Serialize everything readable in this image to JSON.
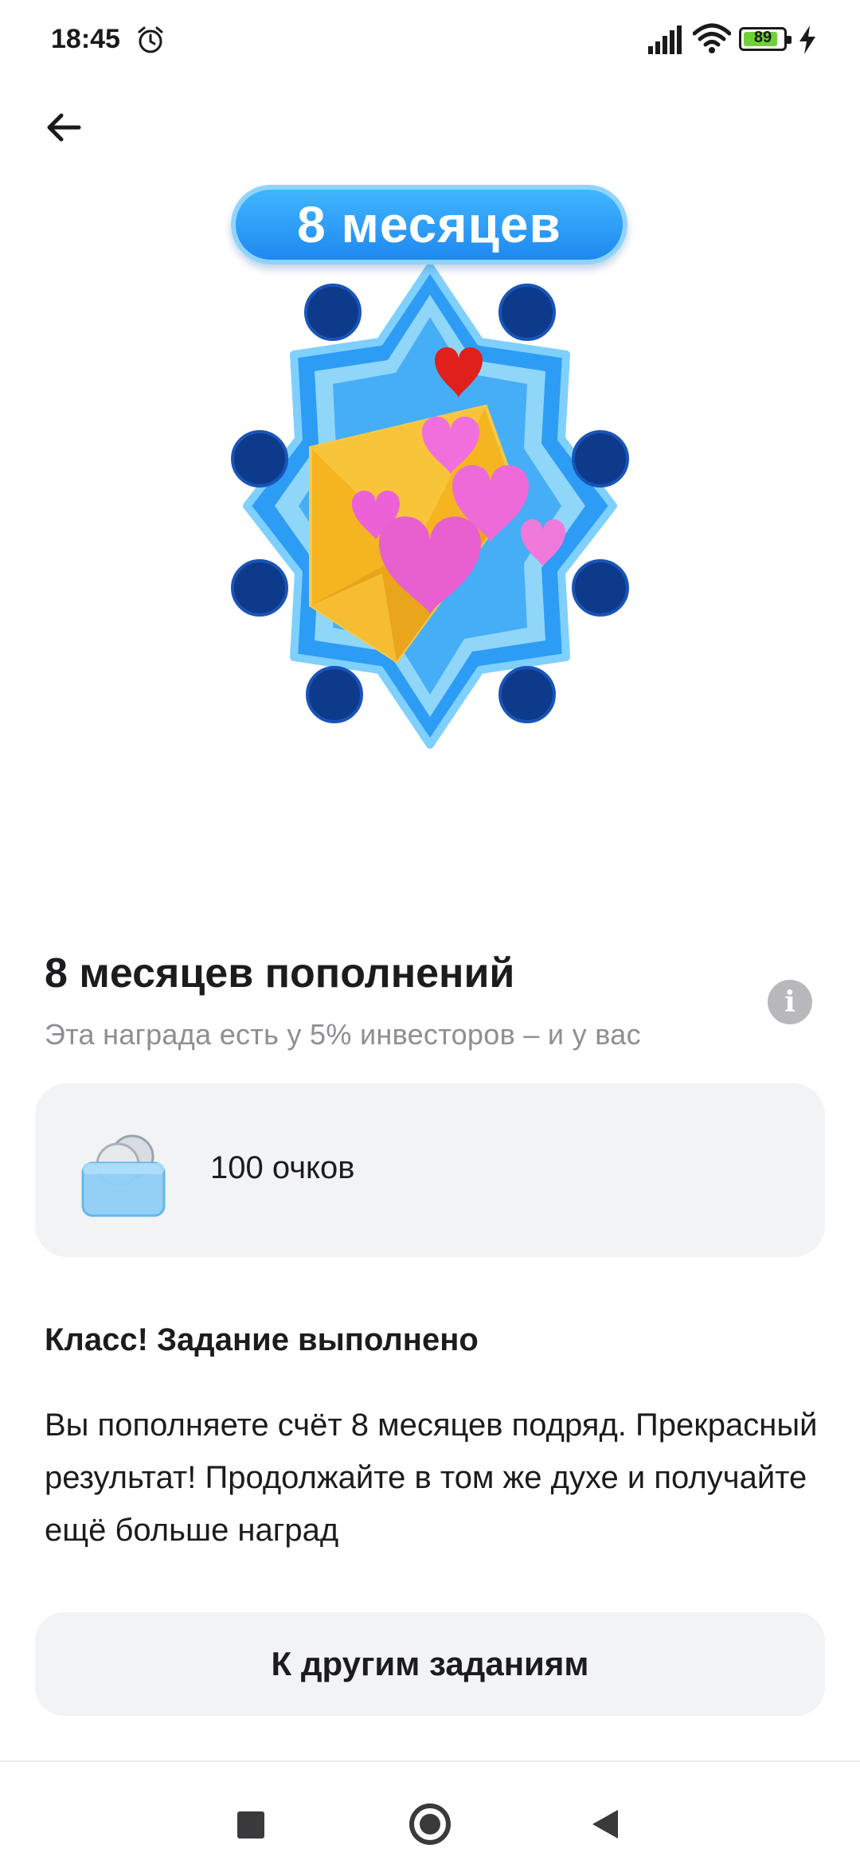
{
  "status_bar": {
    "time": "18:45",
    "battery_level": "89",
    "battery_fraction": 0.89,
    "icons": [
      "alarm-icon",
      "signal-icon",
      "wifi-icon",
      "battery-icon",
      "charging-icon"
    ]
  },
  "toolbar": {
    "back_icon": "arrow-left-icon"
  },
  "medal": {
    "ribbon_text": "8 месяцев",
    "image": "envelope-with-hearts-badge"
  },
  "award": {
    "title": "8 месяцев пополнений",
    "subtitle": "Эта награда есть у 5% инвесторов – и у вас",
    "info_icon": "info-icon"
  },
  "points_card": {
    "icon": "coins-icon",
    "label": "100 очков"
  },
  "task": {
    "heading": "Класс! Задание выполнено",
    "body": "Вы пополняете счёт 8 месяцев подряд. Прекрасный результат! Продолжайте в том же духе и получайте ещё больше наград"
  },
  "cta": {
    "label": "К другим заданиям"
  },
  "nav_bar": {
    "icons": [
      "recents-icon",
      "home-icon",
      "back-icon"
    ]
  },
  "colors": {
    "medal_blue": "#1e88f0",
    "envelope_yellow": "#f4b521",
    "heart_pink": "#e85fd0",
    "heart_red": "#e0201a",
    "card_bg": "#f2f3f5",
    "subtitle_gray": "#8e8e93"
  }
}
